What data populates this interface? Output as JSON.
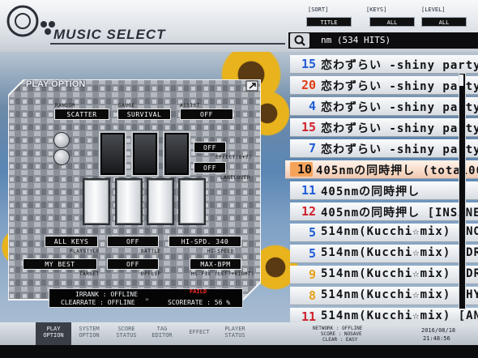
{
  "header": {
    "title": "MUSIC SELECT",
    "sort_label": "[SORT]",
    "sort_value": "TITLE",
    "keys_label": "[KEYS]",
    "keys_value": "ALL",
    "level_label": "[LEVEL]",
    "level_value": "ALL",
    "search_text": "nm (534 HITS)"
  },
  "songs": [
    {
      "level": "15",
      "title": "恋わずらい -shiny party f",
      "color": "#1e5bd8"
    },
    {
      "level": "20",
      "title": "恋わずらい -shiny party f",
      "color": "#e23a12"
    },
    {
      "level": "4",
      "title": "恋わずらい -shiny party f",
      "color": "#1e5bd8"
    },
    {
      "level": "15",
      "title": "恋わずらい -shiny party f",
      "color": "#d0202a"
    },
    {
      "level": "7",
      "title": "恋わずらい -shiny party f",
      "color": "#1e5bd8"
    },
    {
      "level": "10",
      "title": "405nmの同時押し (total00",
      "color": "#101010"
    },
    {
      "level": "11",
      "title": "405nmの同時押し",
      "color": "#1e5bd8"
    },
    {
      "level": "12",
      "title": "405nmの同時押し [INSANE",
      "color": "#d0202a"
    },
    {
      "level": "5",
      "title": "514nm(Kucchi☆mix) [NO",
      "color": "#1e5bd8"
    },
    {
      "level": "5",
      "title": "514nm(Kucchi☆mix) [DR",
      "color": "#1e5bd8"
    },
    {
      "level": "9",
      "title": "514nm(Kucchi☆mix) [DR",
      "color": "#e8a018"
    },
    {
      "level": "8",
      "title": "514nm(Kucchi☆mix) [HY",
      "color": "#e8a018"
    },
    {
      "level": "11",
      "title": "514nm(Kucchi☆mix) [AN",
      "color": "#d0202a"
    }
  ],
  "play_option": {
    "label": "PLAY OPTION",
    "random_caption": "RANDOM",
    "random_value": "SCATTER",
    "gauge_caption": "GAUGE",
    "gauge_value": "SURVIVAL",
    "assist_caption": "ASSIST",
    "assist_value": "OFF",
    "effect_value": "OFF",
    "effect_caption": "EFFECT(6+7)",
    "lanecover_value": "OFF",
    "lanecover_caption": "LANECOVER",
    "playstyle_value": "ALL KEYS",
    "playstyle_caption": "PLAYSTYLE",
    "battle_value": "OFF",
    "battle_caption": "BATTLE",
    "hispeed_value": "HI-SPD. 340",
    "hispeed_caption": "HI-SPEED",
    "target_value": "MY BEST",
    "target_caption": "TARGET",
    "dpflip_value": "OFF",
    "dpflip_caption": "DPFLIP",
    "hsfix_value": "MAX-BPM",
    "hsfix_caption": "HS-FIX (LEFT+RIGHT)"
  },
  "rank": {
    "irrank": "IRRANK : OFFLINE",
    "clearrate": "CLEARRATE : OFFLINE",
    "failed": "FAILD",
    "scorerate": "SCORERATE : 56 %"
  },
  "tabs": [
    {
      "label1": "PLAY",
      "label2": "OPTION"
    },
    {
      "label1": "SYSTEM",
      "label2": "OPTION"
    },
    {
      "label1": "SCORE",
      "label2": "STATUS"
    },
    {
      "label1": "TAG",
      "label2": "EDITOR"
    },
    {
      "label1": "EFFECT",
      "label2": ""
    },
    {
      "label1": "PLAYER",
      "label2": "STATUS"
    }
  ],
  "status": {
    "network": "NETWORK : OFFLINE",
    "score": "SCORE : NOSAVE",
    "clear": "CLEAR : EASY",
    "date": "2016/08/18",
    "time": "21:48:56"
  },
  "colors": {
    "accent_red": "#d0202a",
    "accent_blue": "#1e5bd8",
    "accent_orange": "#e8a018"
  }
}
